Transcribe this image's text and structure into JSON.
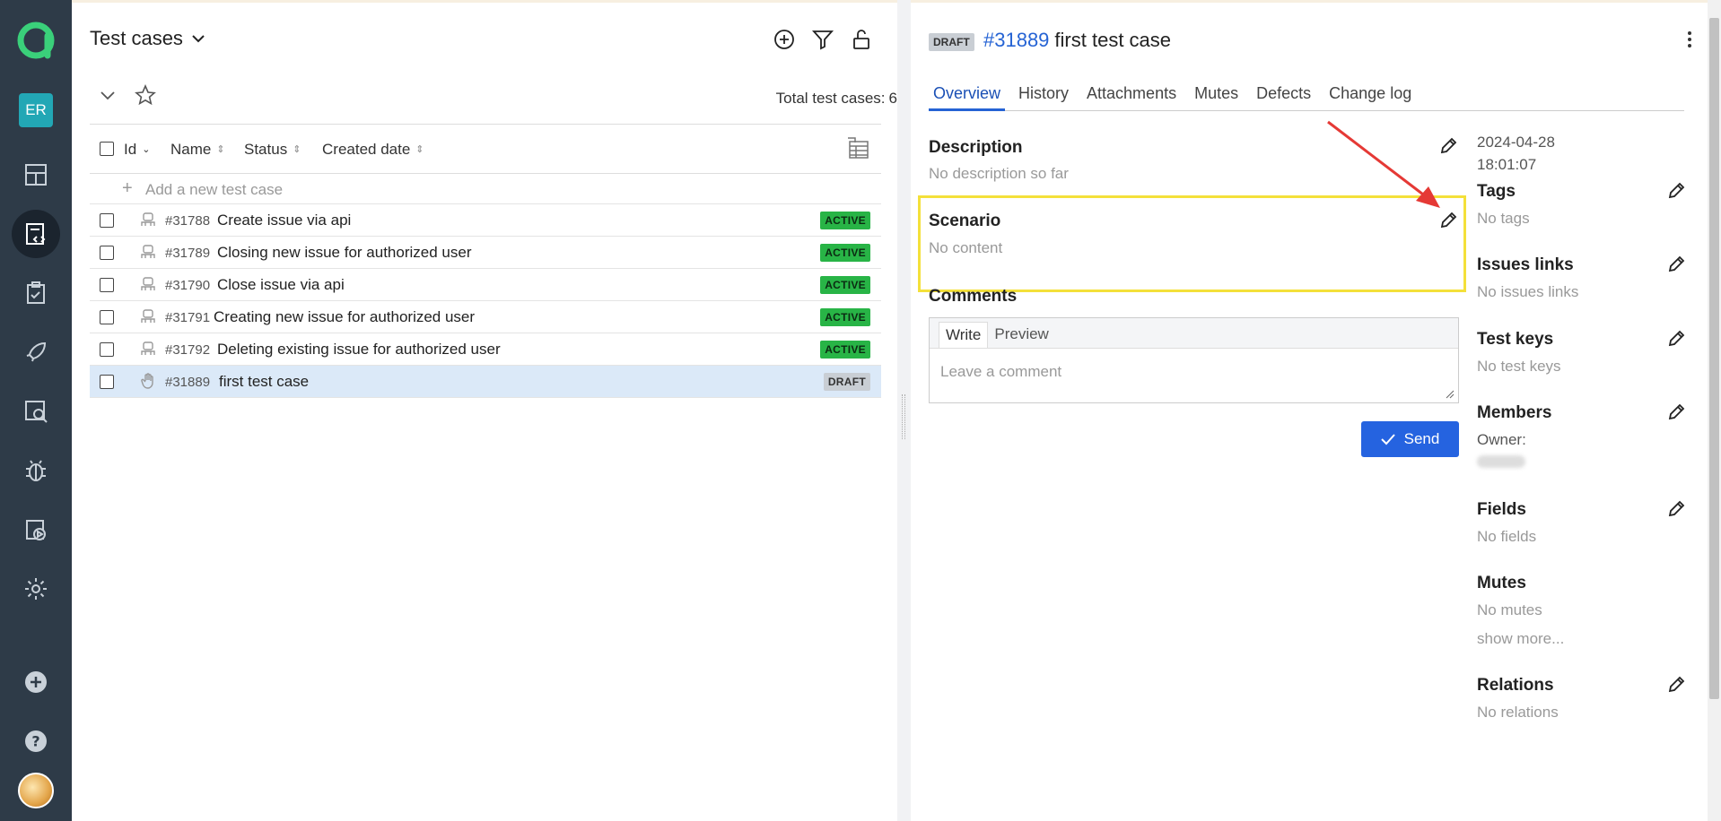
{
  "sidebar": {
    "workspace_badge": "ER",
    "items": [
      {
        "name": "dashboards-icon"
      },
      {
        "name": "test-cases-icon"
      },
      {
        "name": "test-plans-icon"
      },
      {
        "name": "launches-icon"
      },
      {
        "name": "analytics-icon"
      },
      {
        "name": "defects-icon"
      },
      {
        "name": "jobs-icon"
      },
      {
        "name": "settings-icon"
      }
    ]
  },
  "left": {
    "title": "Test cases",
    "total_label": "Total test cases:",
    "total_value": "6",
    "columns": [
      "Id",
      "Name",
      "Status",
      "Created date"
    ],
    "add_placeholder": "Add a new test case",
    "rows": [
      {
        "id": "#31788",
        "name": "Create issue via api",
        "status": "ACTIVE"
      },
      {
        "id": "#31789",
        "name": "Closing new issue for authorized user",
        "status": "ACTIVE"
      },
      {
        "id": "#31790",
        "name": "Close issue via api",
        "status": "ACTIVE"
      },
      {
        "id": "#31791",
        "name": "Creating new issue for authorized user",
        "status": "ACTIVE"
      },
      {
        "id": "#31792",
        "name": "Deleting existing issue for authorized user",
        "status": "ACTIVE"
      },
      {
        "id": "#31889",
        "name": "first test case",
        "status": "DRAFT"
      }
    ]
  },
  "right": {
    "status_badge": "DRAFT",
    "test_id": "#31889",
    "title": "first test case",
    "tabs": [
      "Overview",
      "History",
      "Attachments",
      "Mutes",
      "Defects",
      "Change log"
    ],
    "description": {
      "title": "Description",
      "value": "No description so far"
    },
    "scenario": {
      "title": "Scenario",
      "value": "No content"
    },
    "comments": {
      "title": "Comments",
      "write_tab": "Write",
      "preview_tab": "Preview",
      "placeholder": "Leave a comment",
      "send_label": "Send"
    },
    "meta": {
      "date": "2024-04-28",
      "time": "18:01:07",
      "tags": {
        "title": "Tags",
        "value": "No tags"
      },
      "issues": {
        "title": "Issues links",
        "value": "No issues links"
      },
      "test_keys": {
        "title": "Test keys",
        "value": "No test keys"
      },
      "members": {
        "title": "Members",
        "owner_label": "Owner:"
      },
      "fields": {
        "title": "Fields",
        "value": "No fields"
      },
      "mutes": {
        "title": "Mutes",
        "value": "No mutes",
        "more": "show more..."
      },
      "relations": {
        "title": "Relations",
        "value": "No relations"
      }
    }
  },
  "colors": {
    "sidebar": "#2e3b48",
    "accent": "#2563d4",
    "active_badge": "#28b446",
    "highlight_box": "#f4e03a",
    "arrow": "#e53935"
  }
}
